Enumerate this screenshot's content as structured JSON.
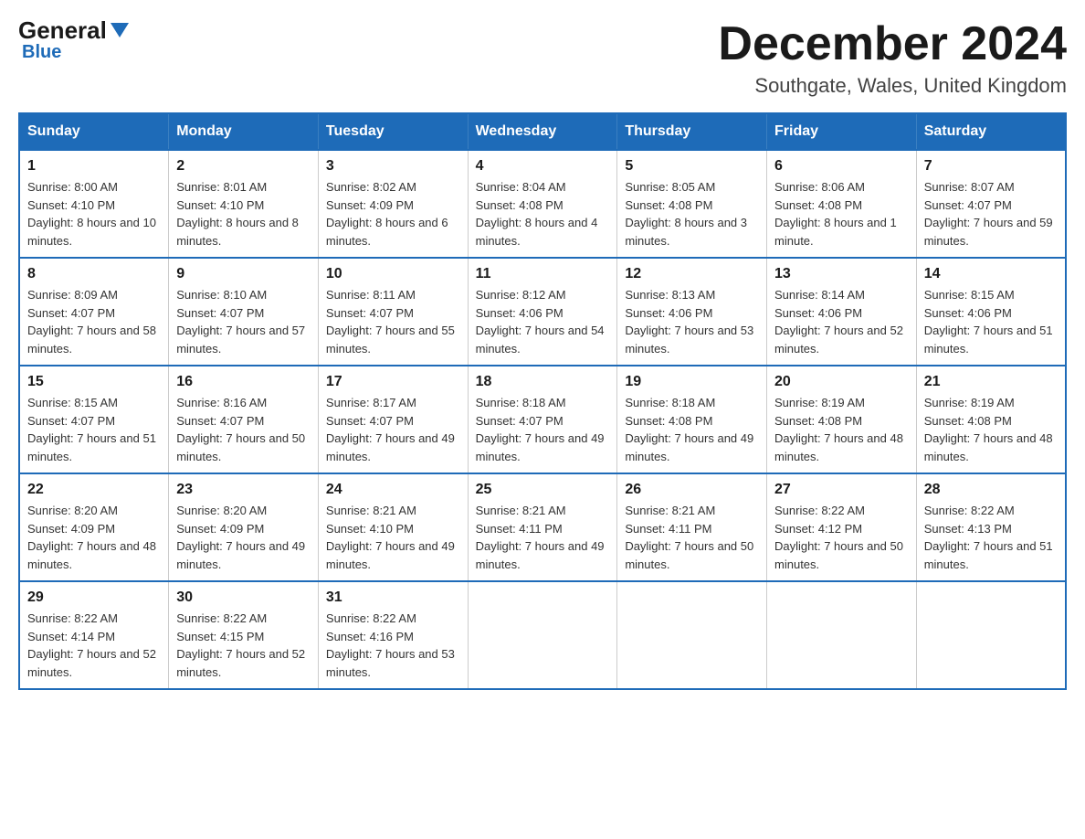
{
  "logo": {
    "general": "General",
    "blue": "Blue"
  },
  "title": {
    "month": "December 2024",
    "location": "Southgate, Wales, United Kingdom"
  },
  "days": {
    "sunday": "Sunday",
    "monday": "Monday",
    "tuesday": "Tuesday",
    "wednesday": "Wednesday",
    "thursday": "Thursday",
    "friday": "Friday",
    "saturday": "Saturday"
  },
  "weeks": [
    {
      "days": [
        {
          "date": "1",
          "sunrise": "8:00 AM",
          "sunset": "4:10 PM",
          "daylight": "8 hours and 10 minutes."
        },
        {
          "date": "2",
          "sunrise": "8:01 AM",
          "sunset": "4:10 PM",
          "daylight": "8 hours and 8 minutes."
        },
        {
          "date": "3",
          "sunrise": "8:02 AM",
          "sunset": "4:09 PM",
          "daylight": "8 hours and 6 minutes."
        },
        {
          "date": "4",
          "sunrise": "8:04 AM",
          "sunset": "4:08 PM",
          "daylight": "8 hours and 4 minutes."
        },
        {
          "date": "5",
          "sunrise": "8:05 AM",
          "sunset": "4:08 PM",
          "daylight": "8 hours and 3 minutes."
        },
        {
          "date": "6",
          "sunrise": "8:06 AM",
          "sunset": "4:08 PM",
          "daylight": "8 hours and 1 minute."
        },
        {
          "date": "7",
          "sunrise": "8:07 AM",
          "sunset": "4:07 PM",
          "daylight": "7 hours and 59 minutes."
        }
      ]
    },
    {
      "days": [
        {
          "date": "8",
          "sunrise": "8:09 AM",
          "sunset": "4:07 PM",
          "daylight": "7 hours and 58 minutes."
        },
        {
          "date": "9",
          "sunrise": "8:10 AM",
          "sunset": "4:07 PM",
          "daylight": "7 hours and 57 minutes."
        },
        {
          "date": "10",
          "sunrise": "8:11 AM",
          "sunset": "4:07 PM",
          "daylight": "7 hours and 55 minutes."
        },
        {
          "date": "11",
          "sunrise": "8:12 AM",
          "sunset": "4:06 PM",
          "daylight": "7 hours and 54 minutes."
        },
        {
          "date": "12",
          "sunrise": "8:13 AM",
          "sunset": "4:06 PM",
          "daylight": "7 hours and 53 minutes."
        },
        {
          "date": "13",
          "sunrise": "8:14 AM",
          "sunset": "4:06 PM",
          "daylight": "7 hours and 52 minutes."
        },
        {
          "date": "14",
          "sunrise": "8:15 AM",
          "sunset": "4:06 PM",
          "daylight": "7 hours and 51 minutes."
        }
      ]
    },
    {
      "days": [
        {
          "date": "15",
          "sunrise": "8:15 AM",
          "sunset": "4:07 PM",
          "daylight": "7 hours and 51 minutes."
        },
        {
          "date": "16",
          "sunrise": "8:16 AM",
          "sunset": "4:07 PM",
          "daylight": "7 hours and 50 minutes."
        },
        {
          "date": "17",
          "sunrise": "8:17 AM",
          "sunset": "4:07 PM",
          "daylight": "7 hours and 49 minutes."
        },
        {
          "date": "18",
          "sunrise": "8:18 AM",
          "sunset": "4:07 PM",
          "daylight": "7 hours and 49 minutes."
        },
        {
          "date": "19",
          "sunrise": "8:18 AM",
          "sunset": "4:08 PM",
          "daylight": "7 hours and 49 minutes."
        },
        {
          "date": "20",
          "sunrise": "8:19 AM",
          "sunset": "4:08 PM",
          "daylight": "7 hours and 48 minutes."
        },
        {
          "date": "21",
          "sunrise": "8:19 AM",
          "sunset": "4:08 PM",
          "daylight": "7 hours and 48 minutes."
        }
      ]
    },
    {
      "days": [
        {
          "date": "22",
          "sunrise": "8:20 AM",
          "sunset": "4:09 PM",
          "daylight": "7 hours and 48 minutes."
        },
        {
          "date": "23",
          "sunrise": "8:20 AM",
          "sunset": "4:09 PM",
          "daylight": "7 hours and 49 minutes."
        },
        {
          "date": "24",
          "sunrise": "8:21 AM",
          "sunset": "4:10 PM",
          "daylight": "7 hours and 49 minutes."
        },
        {
          "date": "25",
          "sunrise": "8:21 AM",
          "sunset": "4:11 PM",
          "daylight": "7 hours and 49 minutes."
        },
        {
          "date": "26",
          "sunrise": "8:21 AM",
          "sunset": "4:11 PM",
          "daylight": "7 hours and 50 minutes."
        },
        {
          "date": "27",
          "sunrise": "8:22 AM",
          "sunset": "4:12 PM",
          "daylight": "7 hours and 50 minutes."
        },
        {
          "date": "28",
          "sunrise": "8:22 AM",
          "sunset": "4:13 PM",
          "daylight": "7 hours and 51 minutes."
        }
      ]
    },
    {
      "days": [
        {
          "date": "29",
          "sunrise": "8:22 AM",
          "sunset": "4:14 PM",
          "daylight": "7 hours and 52 minutes."
        },
        {
          "date": "30",
          "sunrise": "8:22 AM",
          "sunset": "4:15 PM",
          "daylight": "7 hours and 52 minutes."
        },
        {
          "date": "31",
          "sunrise": "8:22 AM",
          "sunset": "4:16 PM",
          "daylight": "7 hours and 53 minutes."
        },
        null,
        null,
        null,
        null
      ]
    }
  ],
  "labels": {
    "sunrise": "Sunrise:",
    "sunset": "Sunset:",
    "daylight": "Daylight:"
  }
}
